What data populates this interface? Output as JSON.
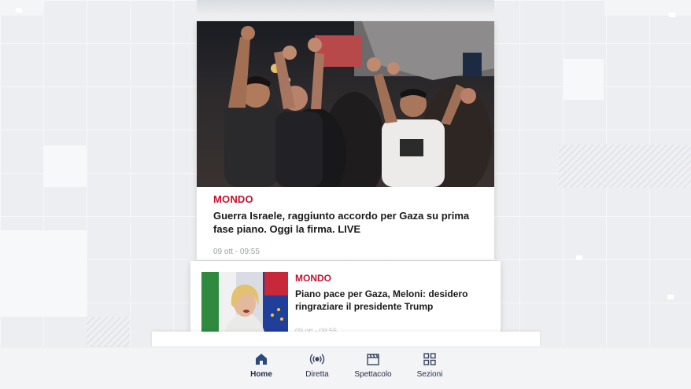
{
  "feed": {
    "main_story": {
      "section": "MONDO",
      "headline": "Guerra Israele, raggiunto accordo per Gaza su prima fase piano. Oggi la firma. LIVE",
      "timestamp": "09 ott - 09:55",
      "image_icon": "crowd-celebration-photo"
    },
    "second_story": {
      "section": "MONDO",
      "headline": "Piano pace per Gaza, Meloni: desidero ringraziare il presidente Trump",
      "timestamp": "09 ott - 09:55",
      "image_icon": "speaker-with-flags-photo"
    }
  },
  "nav": {
    "items": [
      {
        "label": "Home",
        "icon": "home-icon",
        "active": true
      },
      {
        "label": "Diretta",
        "icon": "live-broadcast-icon",
        "active": false
      },
      {
        "label": "Spettacolo",
        "icon": "clapperboard-icon",
        "active": false
      },
      {
        "label": "Sezioni",
        "icon": "grid-icon",
        "active": false
      }
    ]
  },
  "colors": {
    "accent_red": "#c8102e",
    "nav_text": "#1f2a44",
    "active_icon": "#1f3a6b"
  }
}
